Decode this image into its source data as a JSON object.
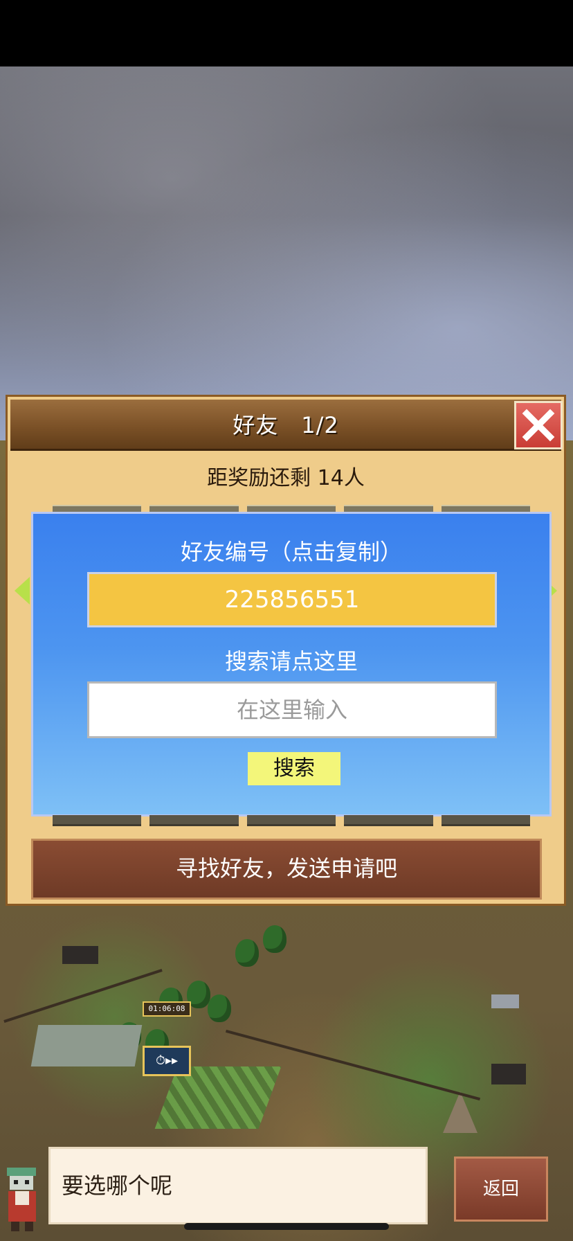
{
  "dialog": {
    "title": "好友　1/2",
    "reward_text": "距奖励还剩 14人",
    "friend_id_label": "好友编号（点击复制）",
    "friend_id": "225856551",
    "search_label": "搜索请点这里",
    "search_placeholder": "在这里输入",
    "search_button": "搜索",
    "banner_text": "寻找好友，发送申请吧"
  },
  "game": {
    "timer": "01:06:08",
    "speed_icon": "stopwatch-fast-forward-icon"
  },
  "footer": {
    "message": "要选哪个呢",
    "back_button": "返回"
  },
  "colors": {
    "panel_blue": "#3a80ee",
    "id_box_yellow": "#f4c542",
    "search_button_yellow": "#f3f67a",
    "close_red": "#d9473f",
    "banner_brown": "#7a3f2a"
  }
}
